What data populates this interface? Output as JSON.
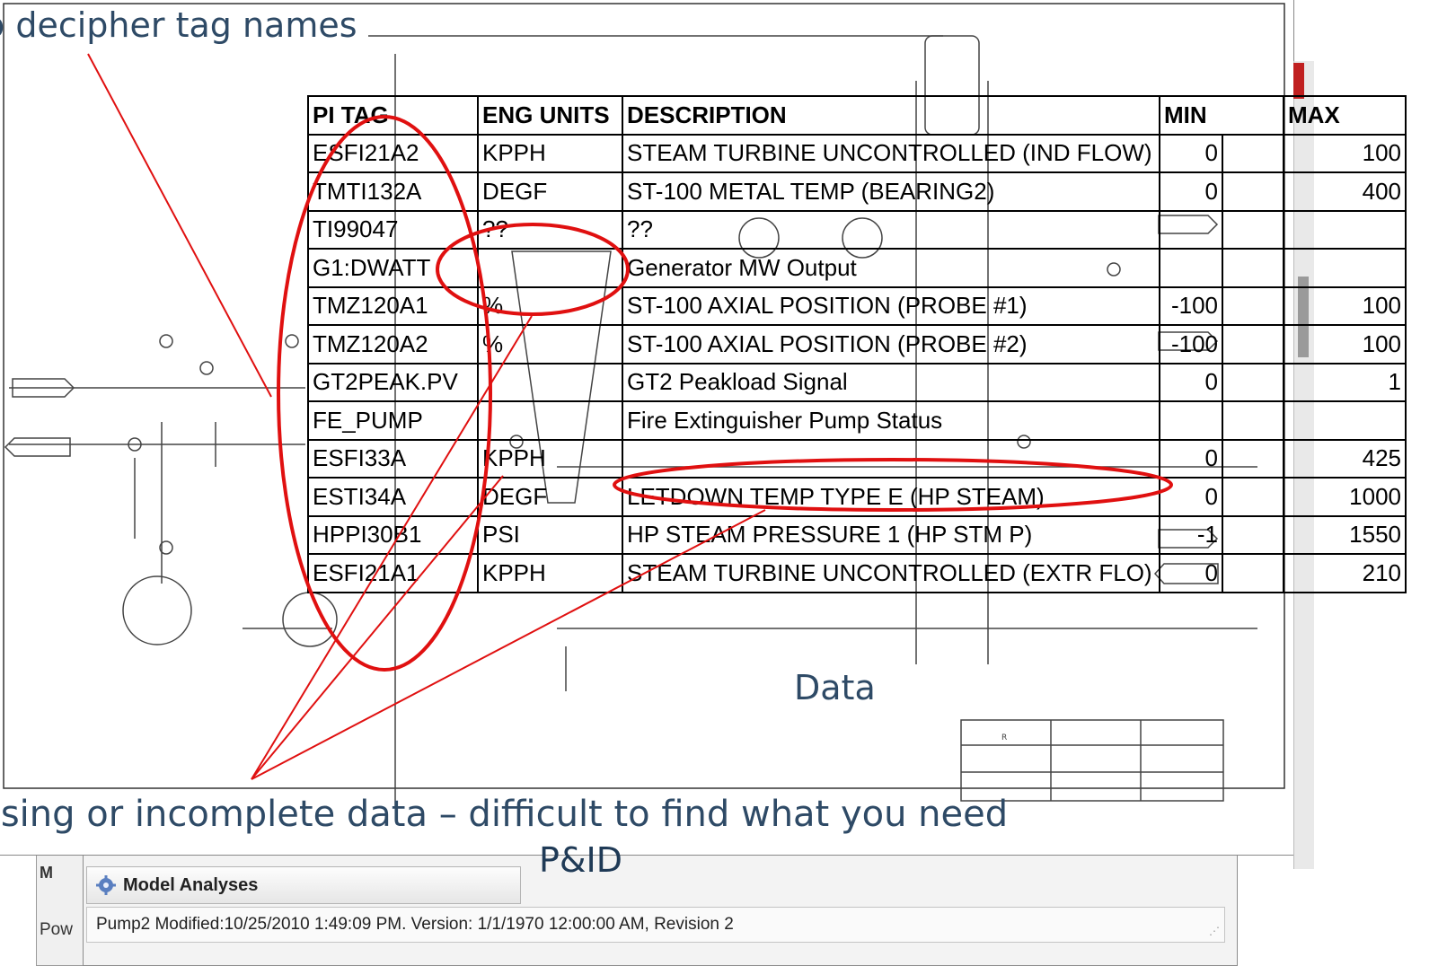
{
  "annotations": {
    "top": "o decipher tag names",
    "bottom": "ssing or incomplete data – difficult to find what you need",
    "data_label": "Data",
    "pid_label": "P&ID"
  },
  "table": {
    "headers": [
      "PI TAG",
      "ENG UNITS",
      "DESCRIPTION",
      "MIN",
      "",
      "MAX"
    ],
    "rows": [
      {
        "tag": "ESFI21A2",
        "units": "KPPH",
        "desc": "STEAM TURBINE UNCONTROLLED (IND FLOW)",
        "min": "0",
        "max": "100"
      },
      {
        "tag": "TMTI132A",
        "units": "DEGF",
        "desc": "ST-100 METAL TEMP (BEARING2)",
        "min": "0",
        "max": "400"
      },
      {
        "tag": "TI99047",
        "units": "??",
        "desc": "??",
        "min": "",
        "max": ""
      },
      {
        "tag": "G1:DWATT",
        "units": "",
        "desc": "Generator MW Output",
        "min": "",
        "max": ""
      },
      {
        "tag": "TMZ120A1",
        "units": "%",
        "desc": "ST-100 AXIAL POSITION (PROBE #1)",
        "min": "-100",
        "max": "100"
      },
      {
        "tag": "TMZ120A2",
        "units": "%",
        "desc": "ST-100 AXIAL POSITION (PROBE #2)",
        "min": "-100",
        "max": "100"
      },
      {
        "tag": "GT2PEAK.PV",
        "units": "",
        "desc": "GT2 Peakload Signal",
        "min": "0",
        "max": "1"
      },
      {
        "tag": "FE_PUMP",
        "units": "",
        "desc": "Fire Extinguisher Pump Status",
        "min": "",
        "max": ""
      },
      {
        "tag": "ESFI33A",
        "units": "KPPH",
        "desc": "",
        "min": "0",
        "max": "425"
      },
      {
        "tag": "ESTI34A",
        "units": "DEGF",
        "desc": "LETDOWN TEMP TYPE E (HP STEAM)",
        "min": "0",
        "max": "1000"
      },
      {
        "tag": "HPPI30B1",
        "units": "PSI",
        "desc": "HP STEAM PRESSURE 1 (HP STM P)",
        "min": "-1",
        "max": "1550"
      },
      {
        "tag": "ESFI21A1",
        "units": "KPPH",
        "desc": "STEAM TURBINE UNCONTROLLED (EXTR FLO)",
        "min": "0",
        "max": "210"
      }
    ]
  },
  "app": {
    "panel_title": "Model Analyses",
    "status_text": "Pump2  Modified:10/25/2010 1:49:09 PM.  Version: 1/1/1970 12:00:00 AM, Revision 2",
    "back_tab_label": "Pow",
    "back_title_fragment": "M"
  },
  "colors": {
    "annotation_red": "#e01010",
    "annotation_text": "#2e4a66"
  }
}
